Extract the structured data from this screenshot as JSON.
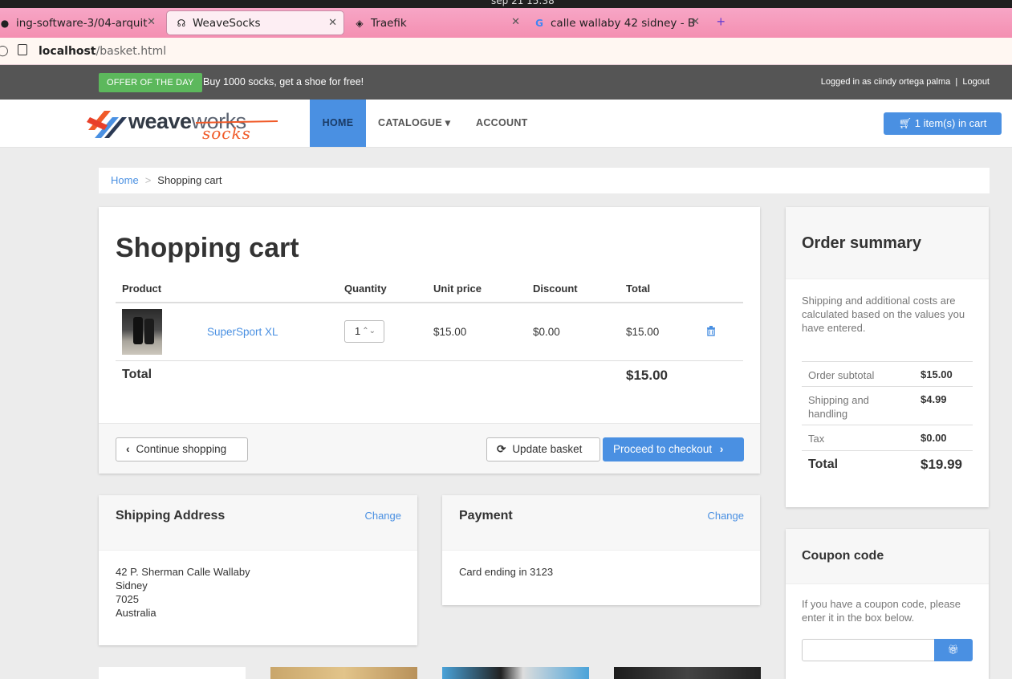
{
  "os": {
    "clock": "sep 21  15:38"
  },
  "browser": {
    "tabs": [
      {
        "label": "ing-software-3/04-arquit"
      },
      {
        "label": "WeaveSocks"
      },
      {
        "label": "Traefik"
      },
      {
        "label": "calle wallaby 42 sidney - B"
      }
    ],
    "url_host": "localhost",
    "url_path": "/basket.html"
  },
  "topbar": {
    "offer_label": "OFFER OF THE DAY",
    "offer_text": "Buy 1000 socks, get a shoe for free!",
    "logged_in": "Logged in as ciindy ortega palma",
    "separator": "|",
    "logout": "Logout"
  },
  "nav": {
    "logo_word_1": "weave",
    "logo_word_2": "works",
    "logo_sub": "socks",
    "home": "HOME",
    "catalogue": "CATALOGUE",
    "account": "ACCOUNT",
    "cart": "1 item(s) in cart"
  },
  "breadcrumb": {
    "home": "Home",
    "separator": ">",
    "current": "Shopping cart"
  },
  "cart": {
    "title": "Shopping cart",
    "headers": {
      "product": "Product",
      "quantity": "Quantity",
      "unit_price": "Unit price",
      "discount": "Discount",
      "total": "Total"
    },
    "items": [
      {
        "name": "SuperSport XL",
        "quantity": "1",
        "unit_price": "$15.00",
        "discount": "$0.00",
        "total": "$15.00"
      }
    ],
    "total_label": "Total",
    "total_value": "$15.00",
    "continue_label": "Continue shopping",
    "update_label": "Update basket",
    "checkout_label": "Proceed to checkout"
  },
  "shipping": {
    "title": "Shipping Address",
    "change": "Change",
    "line1": "42 P. Sherman Calle Wallaby",
    "line2": "Sidney",
    "line3": "7025",
    "line4": "Australia"
  },
  "payment": {
    "title": "Payment",
    "change": "Change",
    "card": "Card ending in 3123"
  },
  "summary": {
    "title": "Order summary",
    "description": "Shipping and additional costs are calculated based on the values you have entered.",
    "rows": [
      {
        "label": "Order subtotal",
        "value": "$15.00"
      },
      {
        "label": "Shipping and handling",
        "value": "$4.99"
      },
      {
        "label": "Tax",
        "value": "$0.00"
      }
    ],
    "total_label": "Total",
    "total_value": "$19.99"
  },
  "coupon": {
    "title": "Coupon code",
    "description": "If you have a coupon code, please enter it in the box below.",
    "input_value": ""
  },
  "colors": {
    "brand_blue": "#4a90e2",
    "offer_green": "#5cb85c",
    "logo_orange": "#f05a28",
    "topbar_gray": "#555555"
  }
}
